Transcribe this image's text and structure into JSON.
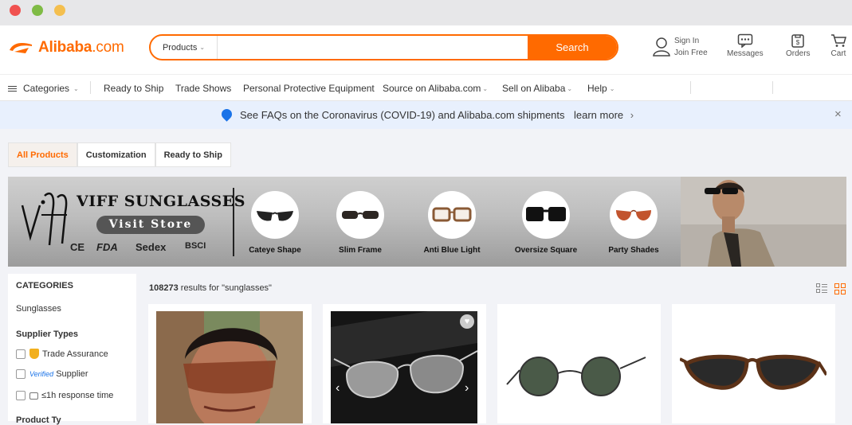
{
  "window": {
    "controls": [
      "close",
      "minimize",
      "maximize"
    ]
  },
  "header": {
    "logo_brand": "Alibaba",
    "logo_domain": ".com",
    "search": {
      "category": "Products",
      "placeholder": "",
      "button": "Search"
    },
    "tools": {
      "sign_in": "Sign In",
      "join_free": "Join Free",
      "messages": "Messages",
      "orders": "Orders",
      "cart": "Cart"
    }
  },
  "nav": {
    "categories": "Categories",
    "items": [
      "Ready to Ship",
      "Trade Shows",
      "Personal Protective Equipment",
      "Source on Alibaba.com",
      "Sell on Alibaba",
      "Help"
    ]
  },
  "notice": {
    "text": "See FAQs on the Coronavirus (COVID-19) and Alibaba.com shipments",
    "link": "learn more"
  },
  "tabs": [
    "All Products",
    "Customization",
    "Ready to Ship"
  ],
  "ad_banner": {
    "brand": "VIFF SUNGLASSES",
    "cta": "Visit Store",
    "certs": [
      "CE",
      "FDA",
      "Sedex",
      "BSCI"
    ],
    "styles": [
      "Cateye Shape",
      "Slim Frame",
      "Anti Blue Light",
      "Oversize Square",
      "Party Shades"
    ]
  },
  "sidebar": {
    "categories_title": "CATEGORIES",
    "category_item": "Sunglasses",
    "supplier_title": "Supplier Types",
    "supplier_options": [
      "Trade Assurance",
      "Supplier",
      "≤1h response time"
    ],
    "verified_label": "Verified",
    "next_title": "Product Ty"
  },
  "results": {
    "count": "108273",
    "suffix": " results for \"sunglasses\""
  },
  "products": [
    {
      "image": "model-wearing-rimless-brown-shield-sunglasses"
    },
    {
      "image": "silver-mirror-aviator-sunglasses"
    },
    {
      "image": "round-metal-frame-green-lens-sunglasses"
    },
    {
      "image": "brown-cat-eye-sunglasses"
    }
  ],
  "colors": {
    "accent": "#ff6a00",
    "notice_bg": "#e8f0fd",
    "nav_link": "#1a73e8"
  }
}
